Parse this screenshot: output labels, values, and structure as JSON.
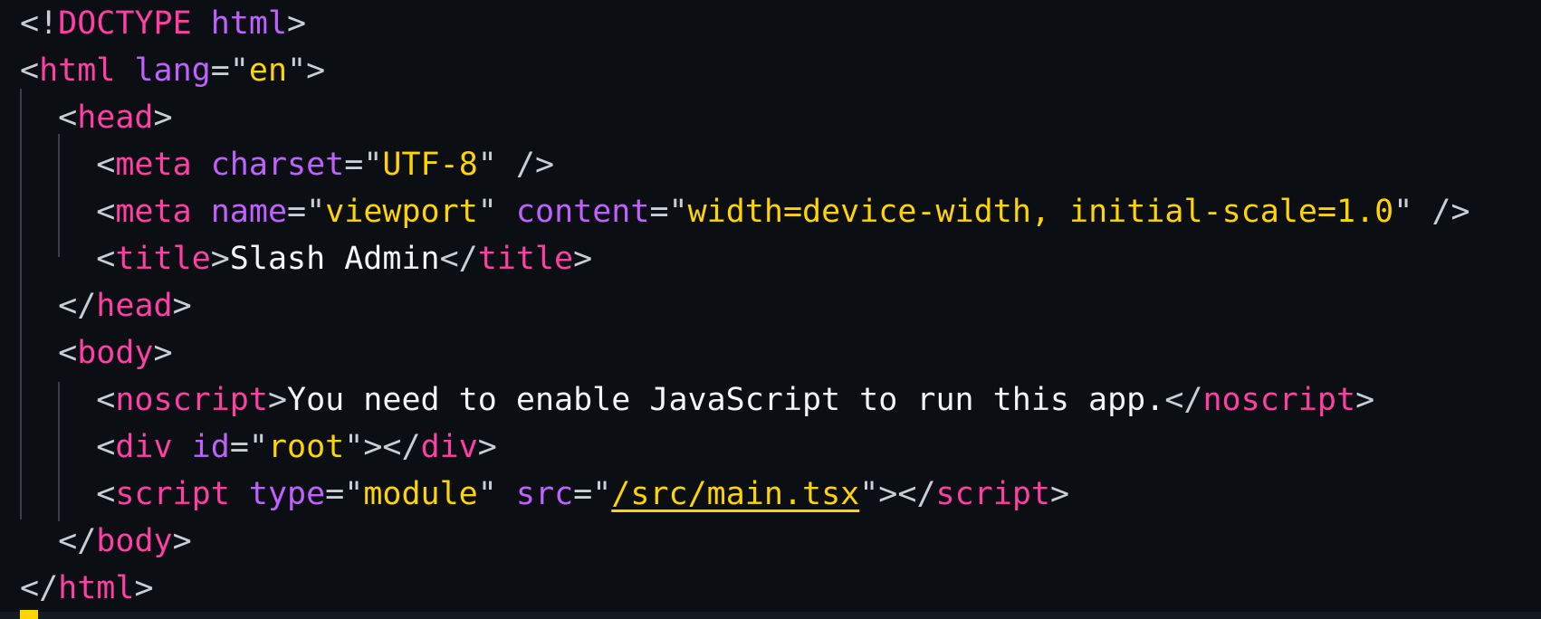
{
  "editor": {
    "lines": [
      {
        "tokens": [
          {
            "k": "p",
            "t": "<!"
          },
          {
            "k": "tag",
            "t": "DOCTYPE"
          },
          {
            "k": "p",
            "t": " "
          },
          {
            "k": "at",
            "t": "html"
          },
          {
            "k": "p",
            "t": ">"
          }
        ]
      },
      {
        "tokens": [
          {
            "k": "p",
            "t": "<"
          },
          {
            "k": "tag",
            "t": "html"
          },
          {
            "k": "p",
            "t": " "
          },
          {
            "k": "at",
            "t": "lang"
          },
          {
            "k": "p",
            "t": "=\""
          },
          {
            "k": "str",
            "t": "en"
          },
          {
            "k": "p",
            "t": "\">"
          }
        ]
      },
      {
        "tokens": [
          {
            "k": "p",
            "t": "  <"
          },
          {
            "k": "tag",
            "t": "head"
          },
          {
            "k": "p",
            "t": ">"
          }
        ]
      },
      {
        "tokens": [
          {
            "k": "p",
            "t": "    <"
          },
          {
            "k": "tag",
            "t": "meta"
          },
          {
            "k": "p",
            "t": " "
          },
          {
            "k": "at",
            "t": "charset"
          },
          {
            "k": "p",
            "t": "=\""
          },
          {
            "k": "str",
            "t": "UTF-8"
          },
          {
            "k": "p",
            "t": "\" />"
          }
        ]
      },
      {
        "tokens": [
          {
            "k": "p",
            "t": "    <"
          },
          {
            "k": "tag",
            "t": "meta"
          },
          {
            "k": "p",
            "t": " "
          },
          {
            "k": "at",
            "t": "name"
          },
          {
            "k": "p",
            "t": "=\""
          },
          {
            "k": "str",
            "t": "viewport"
          },
          {
            "k": "p",
            "t": "\" "
          },
          {
            "k": "at",
            "t": "content"
          },
          {
            "k": "p",
            "t": "=\""
          },
          {
            "k": "str",
            "t": "width=device-width, initial-scale=1.0"
          },
          {
            "k": "p",
            "t": "\" />"
          }
        ]
      },
      {
        "tokens": [
          {
            "k": "p",
            "t": "    <"
          },
          {
            "k": "tag",
            "t": "title"
          },
          {
            "k": "p",
            "t": ">"
          },
          {
            "k": "txt",
            "t": "Slash Admin"
          },
          {
            "k": "p",
            "t": "</"
          },
          {
            "k": "tag",
            "t": "title"
          },
          {
            "k": "p",
            "t": ">"
          }
        ]
      },
      {
        "tokens": [
          {
            "k": "p",
            "t": "  </"
          },
          {
            "k": "tag",
            "t": "head"
          },
          {
            "k": "p",
            "t": ">"
          }
        ]
      },
      {
        "tokens": [
          {
            "k": "p",
            "t": "  <"
          },
          {
            "k": "tag",
            "t": "body"
          },
          {
            "k": "p",
            "t": ">"
          }
        ]
      },
      {
        "tokens": [
          {
            "k": "p",
            "t": "    <"
          },
          {
            "k": "tag",
            "t": "noscript"
          },
          {
            "k": "p",
            "t": ">"
          },
          {
            "k": "txt",
            "t": "You need to enable JavaScript to run this app."
          },
          {
            "k": "p",
            "t": "</"
          },
          {
            "k": "tag",
            "t": "noscript"
          },
          {
            "k": "p",
            "t": ">"
          }
        ]
      },
      {
        "tokens": [
          {
            "k": "p",
            "t": "    <"
          },
          {
            "k": "tag",
            "t": "div"
          },
          {
            "k": "p",
            "t": " "
          },
          {
            "k": "at",
            "t": "id"
          },
          {
            "k": "p",
            "t": "=\""
          },
          {
            "k": "str",
            "t": "root"
          },
          {
            "k": "p",
            "t": "\"></"
          },
          {
            "k": "tag",
            "t": "div"
          },
          {
            "k": "p",
            "t": ">"
          }
        ]
      },
      {
        "tokens": [
          {
            "k": "p",
            "t": "    <"
          },
          {
            "k": "tag",
            "t": "script"
          },
          {
            "k": "p",
            "t": " "
          },
          {
            "k": "at",
            "t": "type"
          },
          {
            "k": "p",
            "t": "=\""
          },
          {
            "k": "str",
            "t": "module"
          },
          {
            "k": "p",
            "t": "\" "
          },
          {
            "k": "at",
            "t": "src"
          },
          {
            "k": "p",
            "t": "=\""
          },
          {
            "k": "link",
            "t": "/src/main.tsx"
          },
          {
            "k": "p",
            "t": "\"></"
          },
          {
            "k": "tag",
            "t": "script"
          },
          {
            "k": "p",
            "t": ">"
          }
        ]
      },
      {
        "tokens": [
          {
            "k": "p",
            "t": "  </"
          },
          {
            "k": "tag",
            "t": "body"
          },
          {
            "k": "p",
            "t": ">"
          }
        ]
      },
      {
        "tokens": [
          {
            "k": "p",
            "t": "</"
          },
          {
            "k": "tag",
            "t": "html"
          },
          {
            "k": "p",
            "t": ">"
          }
        ]
      }
    ]
  },
  "colors": {
    "background": "#0b0f14",
    "tag": "#ff3fa4",
    "attribute": "#c061ff",
    "string": "#ffd400",
    "punctuation": "#c9ced6",
    "text": "#f2f4f7",
    "cursor": "#ffd400"
  }
}
